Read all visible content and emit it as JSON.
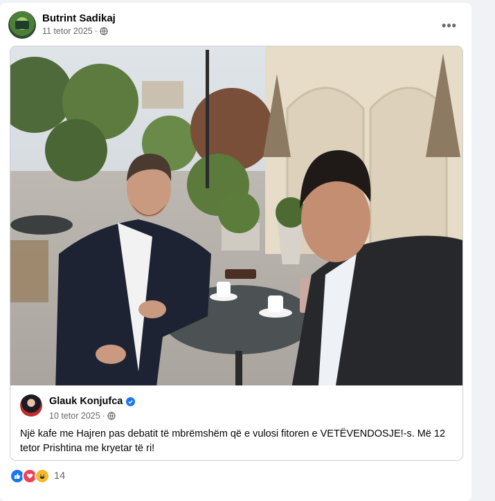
{
  "post": {
    "author": "Butrint Sadikaj",
    "date": "11 tetor 2025",
    "separator": "·",
    "more_icon": "more-horizontal-icon",
    "audience_icon": "globe-icon"
  },
  "shared": {
    "author": "Glauk Konjufca",
    "verified_icon": "verified-badge-icon",
    "date": "10 tetor 2025",
    "separator": "·",
    "text": "Një kafe me Hajren pas debatit të mbrëmshëm që e vulosi fitoren e VETËVENDOSJE!-s. Më 12 tetor Prishtina me kryetar të ri!"
  },
  "reactions": {
    "types": [
      "like",
      "love",
      "haha"
    ],
    "count": "14"
  },
  "colors": {
    "page_bg": "#f0f2f5",
    "card_bg": "#ffffff",
    "meta_text": "#65676b",
    "brand_blue": "#1877f2"
  }
}
